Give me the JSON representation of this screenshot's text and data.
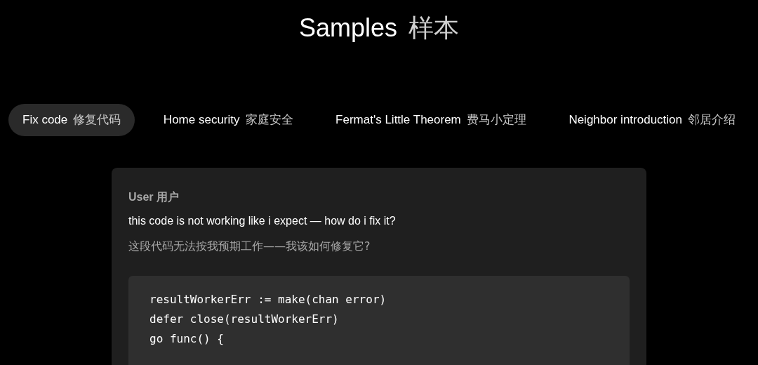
{
  "header": {
    "title_en": "Samples",
    "title_zh": "样本"
  },
  "tabs": [
    {
      "label_en": "Fix code",
      "label_zh": "修复代码",
      "selected": true
    },
    {
      "label_en": "Home security",
      "label_zh": "家庭安全",
      "selected": false
    },
    {
      "label_en": "Fermat's Little Theorem",
      "label_zh": "费马小定理",
      "selected": false
    },
    {
      "label_en": "Neighbor introduction",
      "label_zh": "邻居介绍",
      "selected": false
    }
  ],
  "message": {
    "role": "User 用户",
    "text_en": "this code is not working like i expect — how do i fix it?",
    "text_zh": "这段代码无法按我预期工作——我该如何修复它?",
    "code": [
      "resultWorkerErr := make(chan error)",
      "defer close(resultWorkerErr)",
      "go func() {"
    ]
  }
}
